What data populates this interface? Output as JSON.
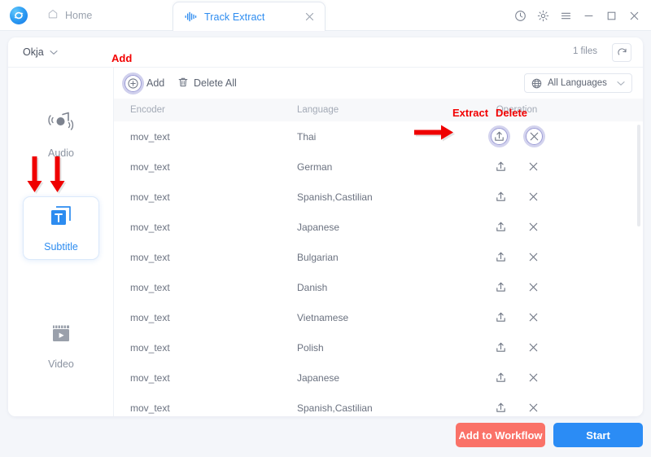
{
  "titlebar": {
    "logo_icon": "app-logo-icon",
    "home_label": "Home",
    "home_icon": "home-icon",
    "tab": {
      "icon": "waveform-icon",
      "label": "Track Extract",
      "close_icon": "close-icon"
    },
    "window_controls": [
      {
        "name": "history-icon",
        "glyph": "clock"
      },
      {
        "name": "settings-icon",
        "glyph": "gear"
      },
      {
        "name": "menu-icon",
        "glyph": "hamburger"
      },
      {
        "name": "minimize-icon",
        "glyph": "minimize"
      },
      {
        "name": "maximize-icon",
        "glyph": "maximize"
      },
      {
        "name": "close-window-icon",
        "glyph": "close"
      }
    ]
  },
  "filebar": {
    "file_name": "Okja",
    "chevron_icon": "chevron-down-icon",
    "file_count": "1 files",
    "refresh_icon": "refresh-icon"
  },
  "sidebar": {
    "items": [
      {
        "id": "audio",
        "label": "Audio",
        "icon": "music-note-icon",
        "active": false
      },
      {
        "id": "subtitle",
        "label": "Subtitle",
        "icon": "subtitle-text-icon",
        "active": true
      },
      {
        "id": "video",
        "label": "Video",
        "icon": "video-clapper-icon",
        "active": false
      }
    ]
  },
  "toolbar": {
    "add_label": "Add",
    "add_icon": "plus-circle-icon",
    "delete_all_label": "Delete All",
    "delete_all_icon": "trash-icon",
    "language_filter": {
      "value": "All Languages",
      "globe_icon": "globe-icon",
      "chevron_icon": "chevron-down-icon"
    }
  },
  "table": {
    "columns": [
      "Encoder",
      "Language",
      "Operation"
    ],
    "rows": [
      {
        "encoder": "mov_text",
        "language": "Thai"
      },
      {
        "encoder": "mov_text",
        "language": "German"
      },
      {
        "encoder": "mov_text",
        "language": "Spanish,Castilian"
      },
      {
        "encoder": "mov_text",
        "language": "Japanese"
      },
      {
        "encoder": "mov_text",
        "language": "Bulgarian"
      },
      {
        "encoder": "mov_text",
        "language": "Danish"
      },
      {
        "encoder": "mov_text",
        "language": "Vietnamese"
      },
      {
        "encoder": "mov_text",
        "language": "Polish"
      },
      {
        "encoder": "mov_text",
        "language": "Japanese"
      },
      {
        "encoder": "mov_text",
        "language": "Spanish,Castilian"
      }
    ],
    "op_extract_icon": "extract-share-icon",
    "op_delete_icon": "delete-x-icon"
  },
  "footer": {
    "add_to_workflow_label": "Add to Workflow",
    "start_label": "Start"
  },
  "annotations": {
    "add": "Add",
    "extract": "Extract",
    "delete": "Delete",
    "arrow_right_icon": "red-arrow-right-icon",
    "arrow_down_icon": "red-arrow-down-icon"
  },
  "colors": {
    "accent_blue": "#2d8cf0",
    "start_button": "#2b8cf5",
    "workflow_button": "#fa7268",
    "annotation_red": "#f20000",
    "highlight_ring": "#9a9ad4"
  }
}
